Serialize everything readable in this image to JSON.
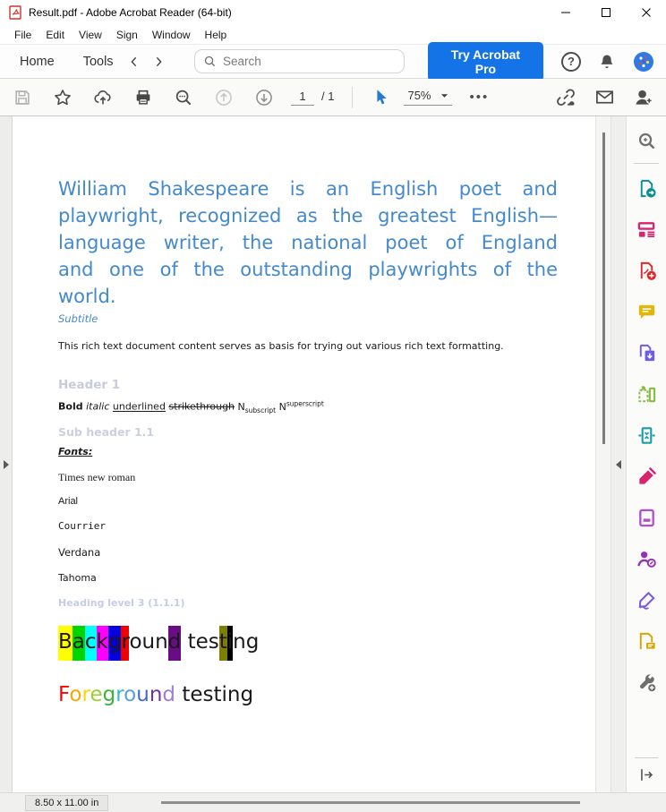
{
  "window": {
    "title": "Result.pdf - Adobe Acrobat Reader (64-bit)"
  },
  "menu": {
    "items": [
      "File",
      "Edit",
      "View",
      "Sign",
      "Window",
      "Help"
    ]
  },
  "toolbar": {
    "home_label": "Home",
    "tools_label": "Tools",
    "search_placeholder": "Search",
    "try_pro_label": "Try Acrobat Pro",
    "help_glyph": "?"
  },
  "doc_toolbar": {
    "page_current": "1",
    "page_separator": "/ 1",
    "zoom_value": "75%",
    "more_label": "•••"
  },
  "document": {
    "title_lines": [
      "William Shakespeare is an English poet and",
      "playwright, recognized as the greatest English—",
      "language writer, the national poet of England",
      "and one of the outstanding playwrights of the",
      "world."
    ],
    "subtitle": "Subtitle",
    "body_text": "This rich text document content serves as basis for trying out various rich text formatting.",
    "header1": "Header 1",
    "format_line": {
      "bold": "Bold",
      "italic": "italic",
      "underlined": "underlined",
      "strikethrough": "strikethrough",
      "n_sub_base": "N",
      "subscript": "subscript",
      "n_sup_base": "N",
      "superscript": "superscript"
    },
    "subheader11": "Sub header 1.1",
    "fonts_label": "Fonts:",
    "font_samples": [
      "Times new roman",
      "Arial",
      "Courrier",
      "Verdana",
      "Tahoma"
    ],
    "heading3": "Heading level 3 (1.1.1)",
    "background_testing": {
      "letters": [
        {
          "t": "B",
          "bg": "#ffff00"
        },
        {
          "t": "a",
          "bg": "#00d500"
        },
        {
          "t": "c",
          "bg": "#00ffff"
        },
        {
          "t": "k",
          "bg": "#ff00ff"
        },
        {
          "t": "g",
          "bg": "#0000e0"
        },
        {
          "t": "r",
          "bg": "#f00000"
        },
        {
          "t": "oun"
        },
        {
          "t": "d",
          "bg": "#6a0d84"
        },
        {
          "t": " tes"
        },
        {
          "t": "t",
          "bg": "#7e7e00"
        },
        {
          "t": "i",
          "bg": "#000000"
        },
        {
          "t": "ng"
        }
      ]
    },
    "foreground_testing": {
      "letters": [
        {
          "t": "F",
          "c": "#ff0000"
        },
        {
          "t": "o",
          "c": "#ffa500"
        },
        {
          "t": "r",
          "c": "#ffd400"
        },
        {
          "t": "e",
          "c": "#9acd32"
        },
        {
          "t": "g",
          "c": "#3cb043"
        },
        {
          "t": "r",
          "c": "#2bbbc8"
        },
        {
          "t": "o",
          "c": "#56a0e0"
        },
        {
          "t": "u",
          "c": "#4169d1"
        },
        {
          "t": "n",
          "c": "#7030a0"
        },
        {
          "t": "d",
          "c": "#9a7fdc"
        },
        {
          "t": " testing",
          "c": "#1a1a1a"
        }
      ]
    }
  },
  "statusbar": {
    "page_size": "8.50 x 11.00 in"
  },
  "colors": {
    "accent_blue": "#1473e6",
    "doc_title_blue": "#4389cb",
    "header_light_gray": "#c7ccdd"
  },
  "icons": {
    "sidebar_tools": [
      "find",
      "export-pdf",
      "edit-pdf",
      "create-pdf",
      "comment",
      "combine-files",
      "organize-pages",
      "compress-pdf",
      "fill-sign-marker",
      "protect-pdf",
      "request-signatures",
      "certificates-sign",
      "send-for-comments",
      "more-tools"
    ]
  }
}
